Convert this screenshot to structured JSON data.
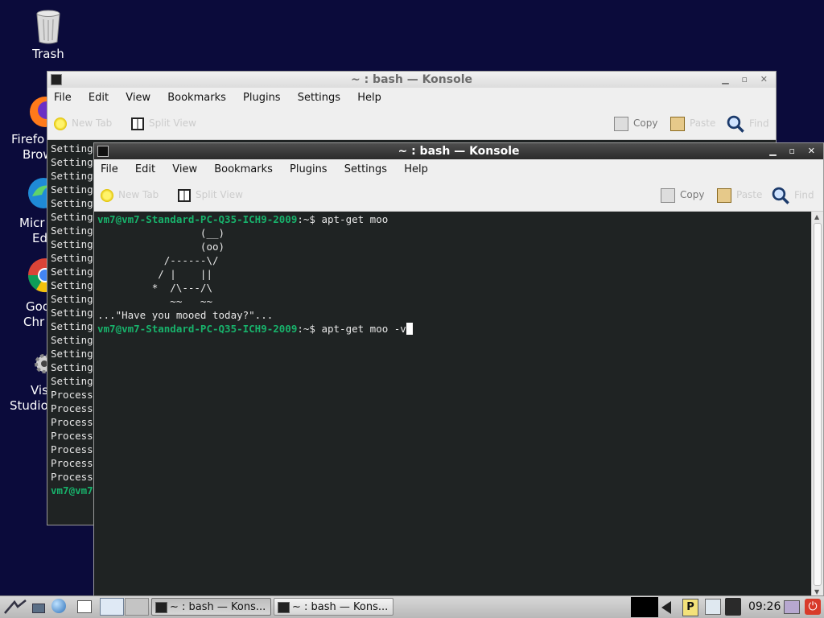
{
  "desktop": {
    "icons": [
      {
        "label": "Trash",
        "name": "trash-icon"
      },
      {
        "label": "Firefox Web Browser",
        "line1": "Firefo",
        "line2": "Brow"
      },
      {
        "label": "Microsoft Edge",
        "line1": "Micr",
        "line2": "Ed"
      },
      {
        "label": "Google Chrome",
        "line1": "Goo",
        "line2": "Chr"
      },
      {
        "label": "Visual Studio",
        "line1": "Vis",
        "line2": "Studio"
      }
    ]
  },
  "back_window": {
    "title": "~ : bash — Konsole",
    "menu": [
      "File",
      "Edit",
      "View",
      "Bookmarks",
      "Plugins",
      "Settings",
      "Help"
    ],
    "toolbar": {
      "new_tab": "New Tab",
      "split_view": "Split View",
      "copy": "Copy",
      "paste": "Paste",
      "find": "Find"
    },
    "lines": [
      "Setting",
      "Setting",
      "Setting",
      "Setting",
      "Setting",
      "Setting",
      "Setting",
      "Setting",
      "Setting",
      "Setting",
      "Setting",
      "Setting",
      "Setting",
      "Setting",
      "Setting",
      "Setting",
      "Setting",
      "Setting",
      "Process",
      "Process",
      "Process",
      "Process",
      "Process",
      "Process",
      "Process"
    ],
    "last_prompt": "vm7@vm7"
  },
  "front_window": {
    "title": "~ : bash — Konsole",
    "menu": [
      "File",
      "Edit",
      "View",
      "Bookmarks",
      "Plugins",
      "Settings",
      "Help"
    ],
    "toolbar": {
      "new_tab": "New Tab",
      "split_view": "Split View",
      "copy": "Copy",
      "paste": "Paste",
      "find": "Find"
    },
    "prompt": "vm7@vm7-Standard-PC-Q35-ICH9-2009",
    "prompt_suffix": ":~$ ",
    "command1": "apt-get moo",
    "cow_art": "                 (__)\n                 (oo)\n           /------\\/\n          / |    ||\n         *  /\\---/\\\n            ~~   ~~",
    "moo_text": "...\"Have you mooed today?\"...",
    "command2": "apt-get moo -v"
  },
  "taskbar": {
    "tasks": [
      {
        "label": "~ : bash — Kons..."
      },
      {
        "label": "~ : bash — Kons..."
      }
    ],
    "clock": "09:26"
  },
  "colors": {
    "prompt": "#18b26b",
    "terminal_bg": "#1f2323",
    "desktop_bg": "#0b0b3b"
  }
}
